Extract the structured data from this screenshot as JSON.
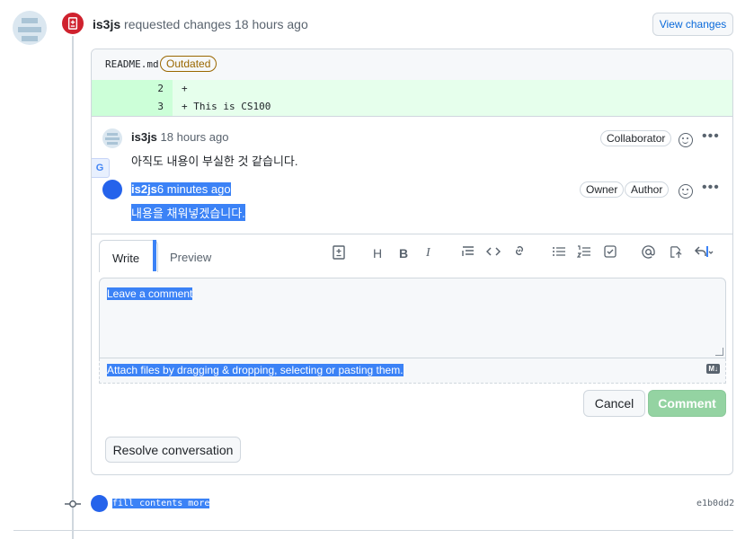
{
  "review": {
    "author": "is3js",
    "action_text": "requested changes 18 hours ago",
    "view_changes_label": "View changes"
  },
  "file": {
    "name": "README.md",
    "status_badge": "Outdated",
    "lines": [
      {
        "num": "2",
        "code": "+"
      },
      {
        "num": "3",
        "code": "+ This is CS100"
      }
    ]
  },
  "comments": [
    {
      "author": "is3js",
      "time": "18 hours ago",
      "badges": [
        "Collaborator"
      ],
      "body": "아직도 내용이 부실한 것 같습니다."
    },
    {
      "author": "is2js",
      "time": "6 minutes ago",
      "badges": [
        "Owner",
        "Author"
      ],
      "body": "내용을 채워넣겠습니다."
    }
  ],
  "editor": {
    "tabs": [
      "Write",
      "Preview"
    ],
    "placeholder": "Leave a comment",
    "attach_text": "Attach files by dragging & dropping, selecting or pasting them.",
    "markdown_badge": "M↓",
    "cancel_label": "Cancel",
    "comment_label": "Comment"
  },
  "resolve_label": "Resolve conversation",
  "commit": {
    "message": "fill contents more",
    "sha": "e1b0dd2"
  },
  "icons": {
    "heading": "H",
    "bold": "B",
    "italic": "I"
  }
}
